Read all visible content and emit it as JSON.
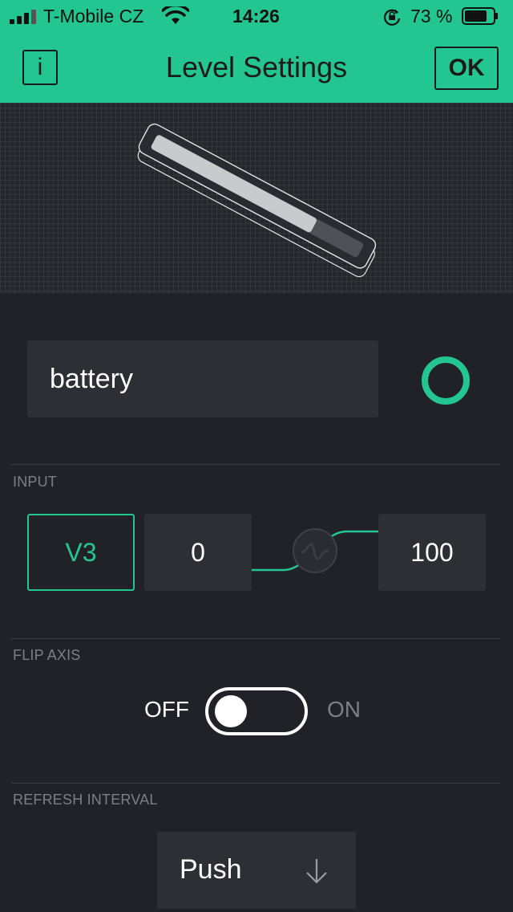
{
  "status_bar": {
    "carrier": "T-Mobile CZ",
    "time": "14:26",
    "battery_percent": "73 %"
  },
  "header": {
    "info_label": "i",
    "title": "Level Settings",
    "ok_label": "OK",
    "accent_color": "#23c690"
  },
  "widget": {
    "name": "battery"
  },
  "input": {
    "section_label": "INPUT",
    "pin": "V3",
    "min": "0",
    "max": "100"
  },
  "flip_axis": {
    "section_label": "FLIP AXIS",
    "off_label": "OFF",
    "on_label": "ON",
    "state": "off"
  },
  "refresh": {
    "section_label": "REFRESH INTERVAL",
    "value": "Push"
  }
}
